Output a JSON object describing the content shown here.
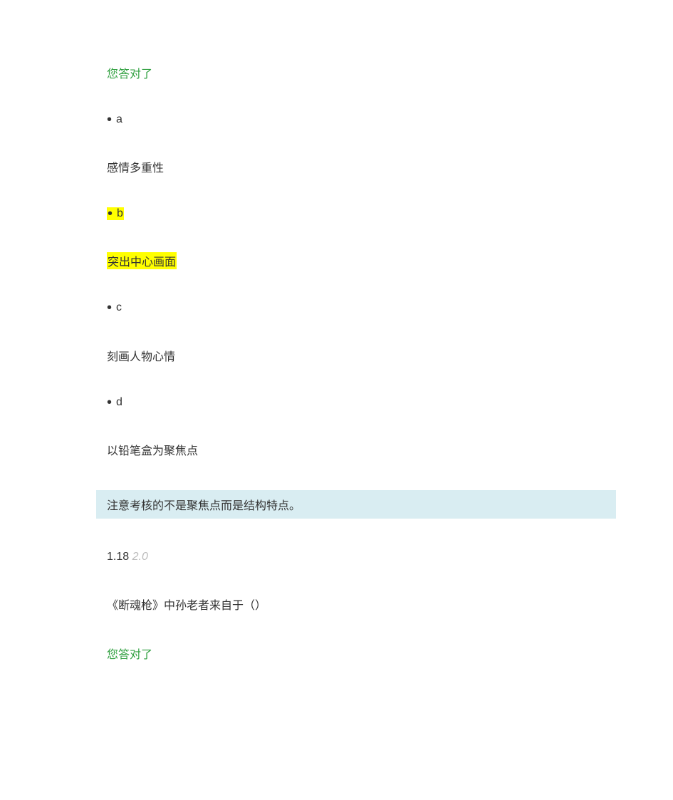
{
  "correct_msg_1": "您答对了",
  "options": {
    "a": {
      "letter": "a",
      "text": "感情多重性",
      "highlighted": false
    },
    "b": {
      "letter": "b",
      "text": "突出中心画面",
      "highlighted": true
    },
    "c": {
      "letter": "c",
      "text": "刻画人物心情",
      "highlighted": false
    },
    "d": {
      "letter": "d",
      "text": "以铅笔盒为聚焦点",
      "highlighted": false
    }
  },
  "note": "注意考核的不是聚焦点而是结构特点。",
  "score": {
    "earned": "1.18",
    "total": "2.0"
  },
  "question": "《断魂枪》中孙老者来自于（）",
  "correct_msg_2": "您答对了",
  "bullet": "•"
}
